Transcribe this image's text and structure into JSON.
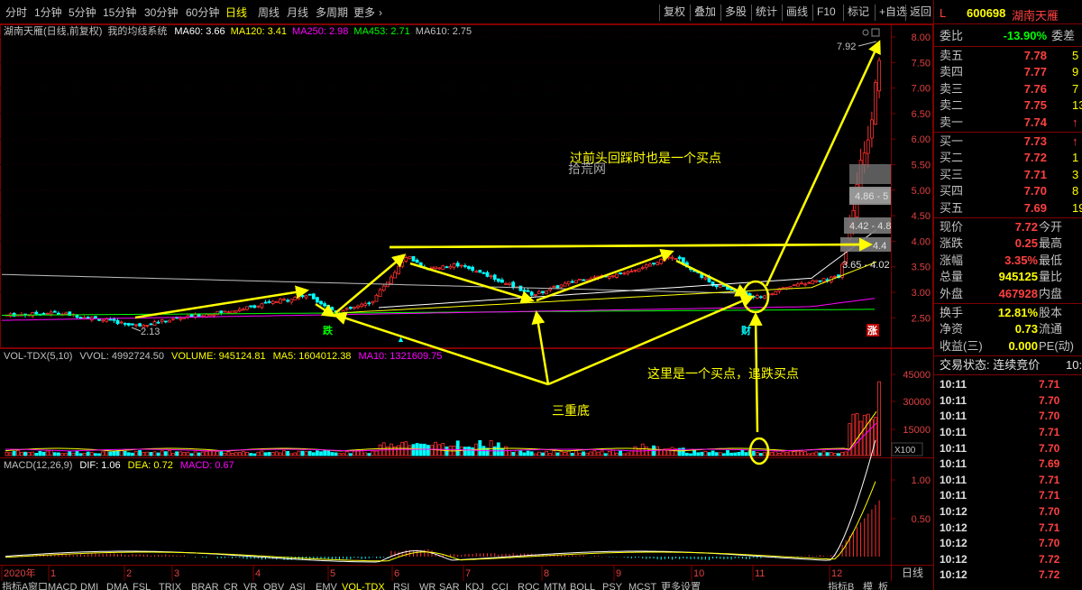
{
  "toolbar": {
    "timeframes": [
      "分时",
      "1分钟",
      "5分钟",
      "15分钟",
      "30分钟",
      "60分钟",
      "日线",
      "周线",
      "月线",
      "多周期",
      "更多"
    ],
    "active_timeframe": "日线",
    "tools": [
      "复权",
      "叠加",
      "多股",
      "统计",
      "画线",
      "F10",
      "标记",
      "+自选",
      "返回"
    ]
  },
  "main_legend": {
    "stock_label": "湖南天雁(日线,前复权)",
    "system": "我的均线系统",
    "ma": [
      {
        "label": "MA60: 3.66",
        "color": "#ffffff"
      },
      {
        "label": "MA120: 3.41",
        "color": "#ffff00"
      },
      {
        "label": "MA250: 2.98",
        "color": "#ff00ff"
      },
      {
        "label": "MA453: 2.71",
        "color": "#00ff00"
      },
      {
        "label": "MA610: 2.75",
        "color": "#c0c0c0"
      }
    ]
  },
  "vol_legend": [
    {
      "label": "VOL-TDX(5,10)",
      "color": "#c0c0c0"
    },
    {
      "label": "VVOL: 4992724.50",
      "color": "#c0c0c0"
    },
    {
      "label": "VOLUME: 945124.81",
      "color": "#ffff00"
    },
    {
      "label": "MA5: 1604012.38",
      "color": "#ffff00"
    },
    {
      "label": "MA10: 1321609.75",
      "color": "#ff00ff"
    }
  ],
  "macd_legend": [
    {
      "label": "MACD(12,26,9)",
      "color": "#c0c0c0"
    },
    {
      "label": "DIF: 1.06",
      "color": "#ffffff"
    },
    {
      "label": "DEA: 0.72",
      "color": "#ffff00"
    },
    {
      "label": "MACD: 0.67",
      "color": "#ff00ff"
    }
  ],
  "price_axis": [
    "8.00",
    "7.50",
    "7.00",
    "6.50",
    "6.00",
    "5.50",
    "5.00",
    "4.50",
    "4.00",
    "3.50",
    "3.00",
    "2.50"
  ],
  "vol_axis": [
    "45000",
    "30000",
    "15000"
  ],
  "vol_unit": "X100",
  "macd_axis": [
    "1.00",
    "0.50"
  ],
  "month_labels": [
    "2020年",
    "1",
    "2",
    "3",
    "4",
    "5",
    "6",
    "7",
    "8",
    "9",
    "10",
    "11",
    "12"
  ],
  "period_label": "日线",
  "price_marks": {
    "high": "7.92",
    "low": "2.13",
    "chip_1": "4.86 - 5",
    "chip_2": "4.42 - 4.8",
    "chip_3": "4.4",
    "chip_4": "3.65 - 4.02"
  },
  "event_badges": [
    "跌",
    "财",
    "涨"
  ],
  "annotations": {
    "text_1": "过前头回踩时也是一个买点",
    "text_2": "这里是一个买点，追跌买点",
    "text_3": "三重底",
    "watermark": "拾荒网"
  },
  "indicators": [
    "指标A",
    "窗口",
    "MACD",
    "DMI",
    "DMA",
    "FSL",
    "TRIX",
    "BRAR",
    "CR",
    "VR",
    "OBV",
    "ASI",
    "EMV",
    "VOL-TDX",
    "RSI",
    "WR",
    "SAR",
    "KDJ",
    "CCI",
    "ROC",
    "MTM",
    "BOLL",
    "PSY",
    "MCST",
    "更多",
    "设置"
  ],
  "indicators_right": [
    "指标B",
    "模",
    "板"
  ],
  "quote": {
    "flag": "L",
    "code": "600698",
    "name": "湖南天雁",
    "weibi_label": "委比",
    "weibi_value": "-13.90%",
    "weicha_label": "委差",
    "asks": [
      {
        "label": "卖五",
        "price": "7.78",
        "vol": "5"
      },
      {
        "label": "卖四",
        "price": "7.77",
        "vol": "9"
      },
      {
        "label": "卖三",
        "price": "7.76",
        "vol": "7"
      },
      {
        "label": "卖二",
        "price": "7.75",
        "vol": "13"
      },
      {
        "label": "卖一",
        "price": "7.74",
        "vol": "↑"
      }
    ],
    "bids": [
      {
        "label": "买一",
        "price": "7.73",
        "vol": "↑"
      },
      {
        "label": "买二",
        "price": "7.72",
        "vol": "1"
      },
      {
        "label": "买三",
        "price": "7.71",
        "vol": "3"
      },
      {
        "label": "买四",
        "price": "7.70",
        "vol": "8"
      },
      {
        "label": "买五",
        "price": "7.69",
        "vol": "19"
      }
    ],
    "stats": [
      {
        "k": "现价",
        "v": "7.72",
        "k2": "今开",
        "color": "#ff4040"
      },
      {
        "k": "涨跌",
        "v": "0.25",
        "k2": "最高",
        "color": "#ff4040"
      },
      {
        "k": "涨幅",
        "v": "3.35%",
        "k2": "最低",
        "color": "#ff4040"
      },
      {
        "k": "总量",
        "v": "945125",
        "k2": "量比",
        "color": "#ffff00"
      },
      {
        "k": "外盘",
        "v": "467928",
        "k2": "内盘",
        "color": "#ff4040"
      }
    ],
    "stats2": [
      {
        "k": "换手",
        "v": "12.81%",
        "k2": "股本",
        "color": "#ffff00"
      },
      {
        "k": "净资",
        "v": "0.73",
        "k2": "流通",
        "color": "#ffff00"
      },
      {
        "k": "收益(三)",
        "v": "0.000",
        "k2": "PE(动)",
        "color": "#ffff00"
      }
    ],
    "trade_status": "交易状态: 连续竞价",
    "trade_status_time": "10:1",
    "trades": [
      {
        "t": "10:11",
        "p": "7.71"
      },
      {
        "t": "10:11",
        "p": "7.70"
      },
      {
        "t": "10:11",
        "p": "7.70"
      },
      {
        "t": "10:11",
        "p": "7.71"
      },
      {
        "t": "10:11",
        "p": "7.70"
      },
      {
        "t": "10:11",
        "p": "7.69"
      },
      {
        "t": "10:11",
        "p": "7.71"
      },
      {
        "t": "10:11",
        "p": "7.71"
      },
      {
        "t": "10:12",
        "p": "7.70"
      },
      {
        "t": "10:12",
        "p": "7.71"
      },
      {
        "t": "10:12",
        "p": "7.70"
      },
      {
        "t": "10:12",
        "p": "7.72"
      },
      {
        "t": "10:12",
        "p": "7.72"
      }
    ]
  },
  "colors": {
    "up": "#ff3030",
    "down": "#00ffff",
    "grid": "#800000",
    "annot": "#ffff00"
  }
}
